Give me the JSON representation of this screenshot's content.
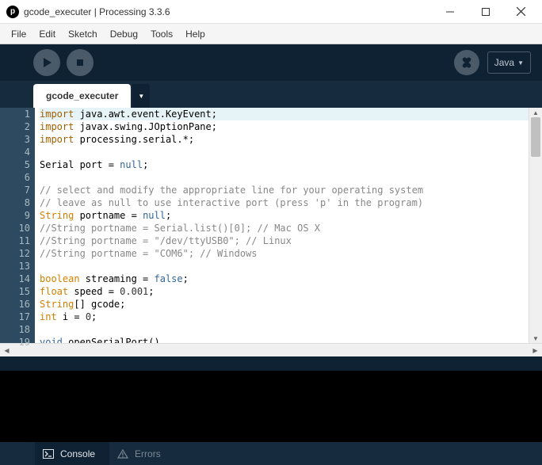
{
  "titlebar": {
    "title": "gcode_executer | Processing 3.3.6",
    "icon_letter": "p"
  },
  "menus": [
    "File",
    "Edit",
    "Sketch",
    "Debug",
    "Tools",
    "Help"
  ],
  "toolbar": {
    "mode_label": "Java"
  },
  "tab": {
    "label": "gcode_executer"
  },
  "editor": {
    "current_line": 1,
    "lines": [
      [
        [
          "import ",
          "kw-import"
        ],
        [
          "java.awt.event.KeyEvent;",
          ""
        ]
      ],
      [
        [
          "import ",
          "kw-import"
        ],
        [
          "javax.swing.JOptionPane;",
          ""
        ]
      ],
      [
        [
          "import ",
          "kw-import"
        ],
        [
          "processing.serial.*;",
          ""
        ]
      ],
      [],
      [
        [
          "Serial port = ",
          ""
        ],
        [
          "null",
          "kw-null"
        ],
        [
          ";",
          ""
        ]
      ],
      [],
      [
        [
          "// select and modify the appropriate line for your operating system",
          "cm-comment"
        ]
      ],
      [
        [
          "// leave as null to use interactive port (press 'p' in the program)",
          "cm-comment"
        ]
      ],
      [
        [
          "String",
          "kw-type"
        ],
        [
          " portname = ",
          ""
        ],
        [
          "null",
          "kw-null"
        ],
        [
          ";",
          ""
        ]
      ],
      [
        [
          "//String portname = Serial.list()[0]; // Mac OS X",
          "cm-comment"
        ]
      ],
      [
        [
          "//String portname = \"/dev/ttyUSB0\"; // Linux",
          "cm-comment"
        ]
      ],
      [
        [
          "//String portname = \"COM6\"; // Windows",
          "cm-comment"
        ]
      ],
      [],
      [
        [
          "boolean",
          "kw-type"
        ],
        [
          " streaming = ",
          ""
        ],
        [
          "false",
          "kw-bool"
        ],
        [
          ";",
          ""
        ]
      ],
      [
        [
          "float",
          "kw-type"
        ],
        [
          " speed = ",
          ""
        ],
        [
          "0.001",
          "cm-num"
        ],
        [
          ";",
          ""
        ]
      ],
      [
        [
          "String",
          "kw-type"
        ],
        [
          "[] gcode;",
          ""
        ]
      ],
      [
        [
          "int",
          "kw-type"
        ],
        [
          " i = ",
          ""
        ],
        [
          "0",
          "cm-num"
        ],
        [
          ";",
          ""
        ]
      ],
      [],
      [
        [
          "void",
          "kw-void"
        ],
        [
          " openSerialPort()",
          ""
        ]
      ]
    ]
  },
  "bottombar": {
    "console_label": "Console",
    "errors_label": "Errors"
  }
}
